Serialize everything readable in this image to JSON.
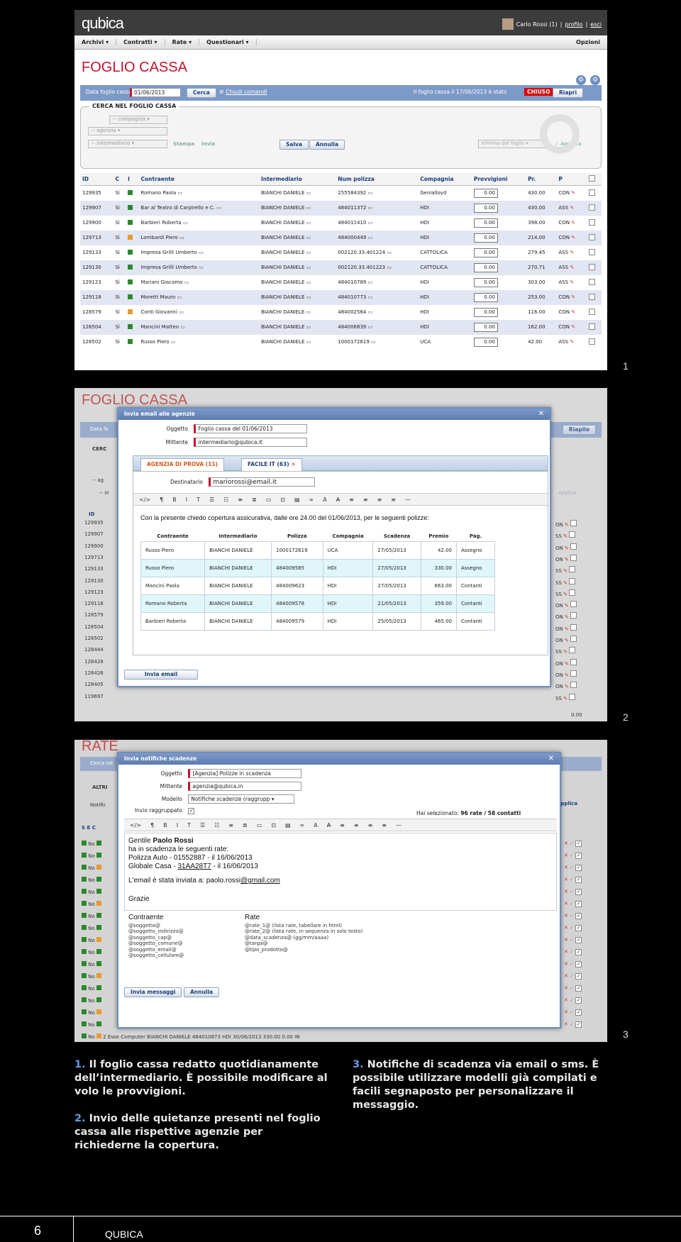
{
  "screen1": {
    "logo": "qubica",
    "user_text": "Carlo Rossi (1)",
    "profilo": "profilo",
    "esci": "esci",
    "separator": "|",
    "menu": [
      "Archivi",
      "Contratti",
      "Rate",
      "Questionari"
    ],
    "opzioni": "Opzioni",
    "title": "FOGLIO CASSA",
    "date_label": "Data foglio cassa",
    "date_value": "01/06/2013",
    "cerca": "Cerca",
    "chiudi_comandi": "Chiudi comandi",
    "status_text": "Il foglio cassa il 17/06/2013 è stato",
    "status_badge": "CHIUSO",
    "riapri": "Riapri",
    "search_legend": "CERCA NEL FOGLIO CASSA",
    "sel_compagnia": "-- compagnia",
    "sel_agenzia": "-- agenzia",
    "sel_intermediario": "-- intermediario",
    "stampa": "Stampa",
    "invia": "Invia",
    "salva": "Salva",
    "annulla": "Annulla",
    "elimina": "elimina dal foglio",
    "applica": "Applica",
    "columns": [
      "ID",
      "C",
      "I",
      "Contraente",
      "Intermediario",
      "Num polizza",
      "Compagnia",
      "Provvigioni",
      "Pr.",
      "P"
    ],
    "rows": [
      {
        "id": "129935",
        "c": "Sì",
        "color": "g",
        "contraente": "Romano Paola",
        "intermediario": "BIANCHI DANIELE",
        "polizza": "255584392",
        "compagnia": "Genialloyd",
        "provv": "0.00",
        "pr": "430.00",
        "p": "CON"
      },
      {
        "id": "129907",
        "c": "Sì",
        "color": "g",
        "contraente": "Bar al Teatro di Carpirello e C.",
        "intermediario": "BIANCHI DANIELE",
        "polizza": "484011372",
        "compagnia": "HDI",
        "provv": "0.00",
        "pr": "430.00",
        "p": "ASS"
      },
      {
        "id": "129900",
        "c": "Sì",
        "color": "g",
        "contraente": "Barbieri Roberta",
        "intermediario": "BIANCHI DANIELE",
        "polizza": "484011410",
        "compagnia": "HDI",
        "provv": "0.00",
        "pr": "398.00",
        "p": "CON"
      },
      {
        "id": "129713",
        "c": "Sì",
        "color": "o",
        "contraente": "Lombardi Piero",
        "intermediario": "BIANCHI DANIELE",
        "polizza": "484000449",
        "compagnia": "HDI",
        "provv": "0.00",
        "pr": "214.00",
        "p": "CON"
      },
      {
        "id": "129133",
        "c": "Sì",
        "color": "g",
        "contraente": "Impresa Grilli Umberto",
        "intermediario": "BIANCHI DANIELE",
        "polizza": "002120.33.401224",
        "compagnia": "CATTOLICA",
        "provv": "0.00",
        "pr": "279.45",
        "p": "ASS"
      },
      {
        "id": "129130",
        "c": "Sì",
        "color": "g",
        "contraente": "Impresa Grilli Umberto",
        "intermediario": "BIANCHI DANIELE",
        "polizza": "002120.33.401223",
        "compagnia": "CATTOLICA",
        "provv": "0.00",
        "pr": "270.71",
        "p": "ASS"
      },
      {
        "id": "129123",
        "c": "Sì",
        "color": "g",
        "contraente": "Mariani Giacomo",
        "intermediario": "BIANCHI DANIELE",
        "polizza": "484010789",
        "compagnia": "HDI",
        "provv": "0.00",
        "pr": "303.00",
        "p": "ASS"
      },
      {
        "id": "129118",
        "c": "Sì",
        "color": "g",
        "contraente": "Moretti Mauro",
        "intermediario": "BIANCHI DANIELE",
        "polizza": "484010773",
        "compagnia": "HDI",
        "provv": "0.00",
        "pr": "253.00",
        "p": "CON"
      },
      {
        "id": "128579",
        "c": "Sì",
        "color": "o",
        "contraente": "Conti Giovanni",
        "intermediario": "BIANCHI DANIELE",
        "polizza": "484002564",
        "compagnia": "HDI",
        "provv": "0.00",
        "pr": "116.00",
        "p": "CON"
      },
      {
        "id": "128504",
        "c": "Sì",
        "color": "g",
        "contraente": "Mancini Matteo",
        "intermediario": "BIANCHI DANIELE",
        "polizza": "484006839",
        "compagnia": "HDI",
        "provv": "0.00",
        "pr": "162.00",
        "p": "CON"
      },
      {
        "id": "128502",
        "c": "Sì",
        "color": "g",
        "contraente": "Russo Piero",
        "intermediario": "BIANCHI DANIELE",
        "polizza": "1000172619",
        "compagnia": "UCA",
        "provv": "0.00",
        "pr": "42.00",
        "p": "ASS"
      }
    ]
  },
  "screen2": {
    "bg_title": "FOGLIO CASSA",
    "bg_date": "Data fo",
    "bg_cerca": "CERC",
    "bg_ag": "-- ag",
    "bg_in": "-- in",
    "bg_riapri": "Riapilo",
    "bg_applica": "Applica",
    "bg_total": "0.00",
    "bg_id_header": "ID",
    "bg_ids": [
      "129935",
      "129907",
      "129900",
      "129713",
      "129133",
      "129130",
      "129123",
      "129118",
      "128579",
      "128504",
      "128502",
      "128444",
      "128428",
      "128426",
      "128405",
      "119697"
    ],
    "bg_right": [
      "ON",
      "SS",
      "ON",
      "ON",
      "SS",
      "SS",
      "SS",
      "ON",
      "ON",
      "ON",
      "ON",
      "SS",
      "ON",
      "ON",
      "ON",
      "SS"
    ],
    "dialog_title": "Invia email alle agenzie",
    "oggetto_label": "Oggetto",
    "oggetto_value": "Foglio cassa del 01/06/2013",
    "mittente_label": "Mittente",
    "mittente_value": "intermediario@qubica.it",
    "tab1": "AGENZIA DI PROVA (11)",
    "tab2": "FACILE IT (63)",
    "destinatario_label": "Destinatario",
    "destinatario_value": "mariorossi@email.it",
    "toolbar": [
      "</>",
      "¶",
      "B",
      "I",
      "T",
      "☰",
      "☷",
      "≡",
      "≣",
      "▭",
      "⊡",
      "▤",
      "∞",
      "A",
      "A̶",
      "≡",
      "≡",
      "≡",
      "≡",
      "—"
    ],
    "body_text": "Con la presente chiedo copertura assicurativa, dalle ore 24.00 del 01/06/2013, per le seguenti polizze:",
    "table_headers": [
      "Contraente",
      "Intermediario",
      "Polizza",
      "Compagnia",
      "Scadenza",
      "Premio",
      "Pag."
    ],
    "table_rows": [
      [
        "Russo Piero",
        "BIANCHI DANIELE",
        "1000172619",
        "UCA",
        "27/05/2013",
        "42.00",
        "Assegno"
      ],
      [
        "Russo Piero",
        "BIANCHI DANIELE",
        "484009585",
        "HDI",
        "27/05/2013",
        "330.00",
        "Assegno"
      ],
      [
        "Mancini Paola",
        "BIANCHI DANIELE",
        "484009623",
        "HDI",
        "27/05/2013",
        "663.00",
        "Contanti"
      ],
      [
        "Romano Roberta",
        "BIANCHI DANIELE",
        "484009578",
        "HDI",
        "21/05/2013",
        "359.00",
        "Contanti"
      ],
      [
        "Barbieri Roberta",
        "BIANCHI DANIELE",
        "484009579",
        "HDI",
        "25/05/2013",
        "465.00",
        "Contanti"
      ]
    ],
    "invia_email": "Invia email"
  },
  "screen3": {
    "bg_title": "RATE",
    "bg_cerca": "Cerca rat",
    "bg_altri": "ALTRI",
    "bg_notific": "Notific",
    "bg_applica": "Applica",
    "bg_header": "S E C",
    "bg_no": "No",
    "bg_last_row": "2 Esse Computer    BIANCHI DANIELE   484010873    HDI             30/06/2013  330.00  0.00  IN",
    "dialog_title": "Invia notifiche scadenze",
    "oggetto_label": "Oggetto",
    "oggetto_value": "[Agenzia] Polizze in scadenza",
    "mittente_label": "Mittente",
    "mittente_value": "agenzia@qubica.in",
    "modello_label": "Modello",
    "modello_value": "Notifiche scadenze (raggrupp",
    "raggruppato_label": "Invio raggruppato",
    "selezionato_label": "Hai selezionato:",
    "selezionato_value": "96 rate / 58 contatti",
    "greeting_pre": "Gentile",
    "greeting_name": "Paolo Rossi",
    "line1": "ha in scadenza le seguenti rate:",
    "line2": "Polizza Auto - 01552887 - il 16/06/2013",
    "line3_pre": "Globale Casa -",
    "line3_link": "31AA28T7",
    "line3_post": "- il 16/06/2013",
    "line4_pre": "L'email è stata inviata a: paolo.rossi",
    "line4_link": "@gmail.com",
    "grazie": "Grazie",
    "col1_title": "Contraente",
    "col1_items": [
      "@soggetto@",
      "@soggetto_indirizzo@",
      "@soggetto_cap@",
      "@soggetto_comune@",
      "@soggetto_email@",
      "@soggetto_cellulare@"
    ],
    "col2_title": "Rate",
    "col2_items": [
      "@rate_1@ (lista rate, tabellare in html)",
      "@rate_2@ (lista rate, in sequenza in solo testo)",
      "@data_scadenza@ (gg/mm/aaaa)",
      "@targa@",
      "@tipo_prodotto@"
    ],
    "invia_messaggi": "Invia messaggi",
    "annulla": "Annulla"
  },
  "numbers": [
    "1",
    "2",
    "3"
  ],
  "captions": {
    "c1_num": "1.",
    "c1_text": "Il foglio cassa redatto quotidianamente dell’intermediario. È possibile modificare al volo le provvigioni.",
    "c2_num": "2.",
    "c2_text": "Invio delle quietanze presenti nel foglio cassa alle rispettive agenzie per richiederne la copertura.",
    "c3_num": "3.",
    "c3_text": "Notifiche di scadenza via email o sms. È possibile utilizzare modelli già compilati e facili segnaposto per personalizzare il messaggio."
  },
  "footer": {
    "page": "6",
    "brand": "QUBICA"
  }
}
